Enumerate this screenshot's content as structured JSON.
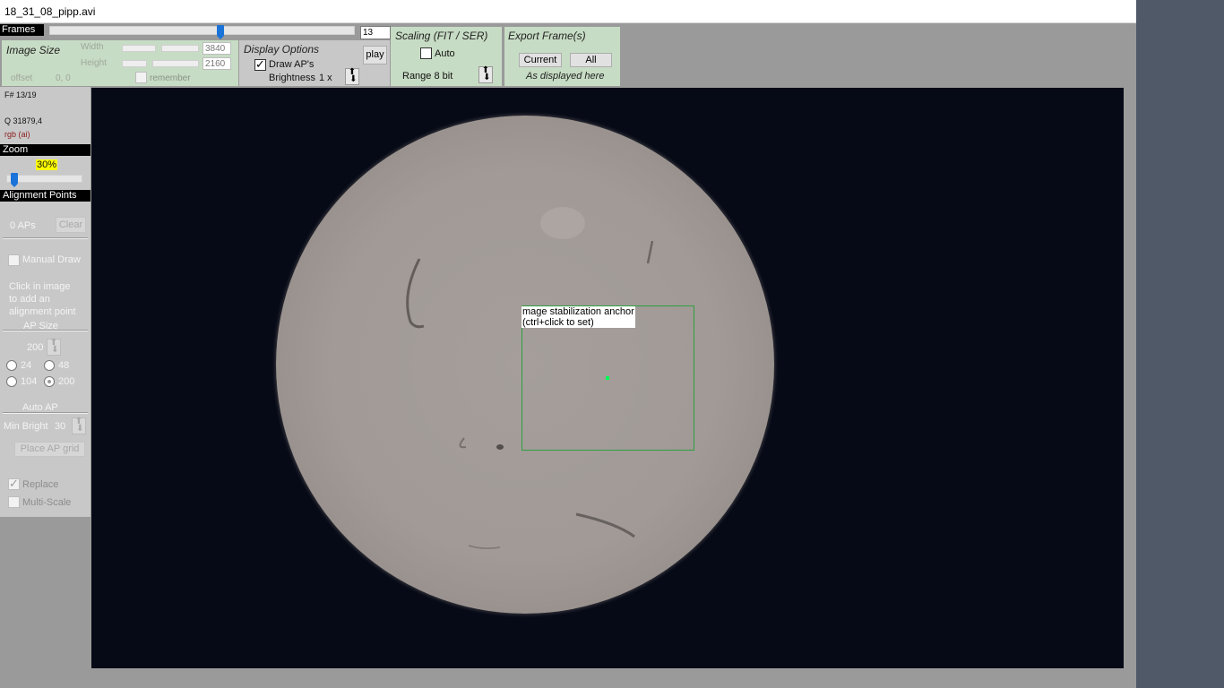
{
  "window": {
    "title": "18_31_08_pipp.avi"
  },
  "frames": {
    "label": "Frames",
    "value": "13",
    "position": 0.56
  },
  "image_size": {
    "title": "Image Size",
    "width_label": "Width",
    "width_value": "3840",
    "height_label": "Height",
    "height_value": "2160",
    "offset_label": "offset",
    "offset_value": "0, 0",
    "remember_label": "remember"
  },
  "display_options": {
    "title": "Display Options",
    "draw_aps_label": "Draw AP's",
    "draw_aps_checked": true,
    "brightness_label": "Brightness",
    "brightness_value": "1 x",
    "play_label": "play"
  },
  "scaling": {
    "title": "Scaling (FIT / SER)",
    "auto_label": "Auto",
    "range_label": "Range 8 bit"
  },
  "export": {
    "title": "Export Frame(s)",
    "current_label": "Current",
    "all_label": "All",
    "note": "As displayed here"
  },
  "info": {
    "frame": "F# 13/19",
    "quality": "Q  31879,4",
    "mode": "rgb (ai)"
  },
  "zoom": {
    "header": "Zoom",
    "value": "30%",
    "position": 0.1
  },
  "alignment": {
    "header": "Alignment Points",
    "ap_count": "0 APs",
    "clear_label": "Clear",
    "manual_draw_label": "Manual Draw",
    "hint_line1": "Click in image",
    "hint_line2": "to add an",
    "hint_line3": "alignment point",
    "ap_size_label": "AP Size",
    "ap_size_value": "200",
    "sizes": [
      "24",
      "48",
      "104",
      "200"
    ],
    "auto_ap_label": "Auto AP",
    "min_bright_label": "Min Bright",
    "min_bright_value": "30",
    "place_grid_label": "Place AP grid",
    "replace_label": "Replace",
    "multiscale_label": "Multi-Scale"
  },
  "viewer": {
    "anchor_line1": "mage stabilization anchor",
    "anchor_line2": "(ctrl+click to set)"
  },
  "colors": {
    "panel_green": "#c7dcc4",
    "panel_gray": "#c8c8c8",
    "slider_thumb": "#1a73d9",
    "anchor_box": "#2ea043",
    "zoom_highlight": "#ffff00",
    "viewer_bg": "#060a16"
  }
}
